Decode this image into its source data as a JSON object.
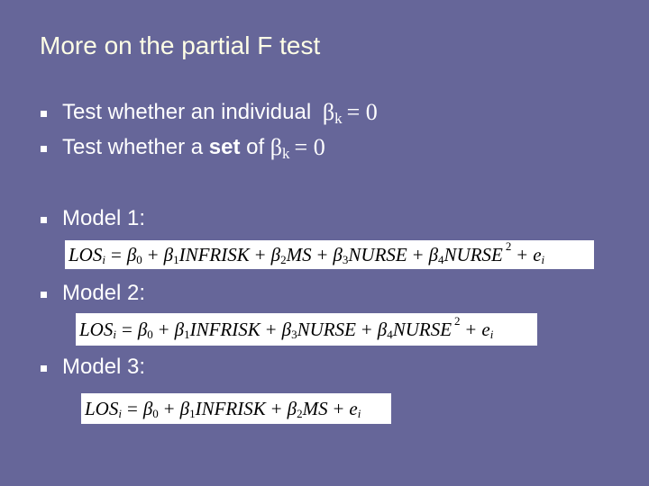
{
  "slide": {
    "title": "More on the partial F test",
    "background_color": "#666699",
    "title_color": "#FFFFE6",
    "bullets": [
      {
        "prefix": "Test whether an individual ",
        "bold": "",
        "suffix": "",
        "symbol": "β",
        "subscript": "k",
        "equals": "= 0"
      },
      {
        "prefix": "Test whether a ",
        "bold": "set",
        "suffix": " of ",
        "symbol": "β",
        "subscript": "k",
        "equals": "= 0"
      },
      {
        "label": "Model 1:"
      },
      {
        "label": "Model 2:"
      },
      {
        "label": "Model 3:"
      }
    ],
    "bullet_icon": "square-bullet",
    "models": [
      {
        "name": "Model 1",
        "lhs": "LOS",
        "lhs_sub": "i",
        "terms": [
          {
            "coef": "β",
            "sub": "0",
            "var": ""
          },
          {
            "coef": "β",
            "sub": "1",
            "var": "INFRISK"
          },
          {
            "coef": "β",
            "sub": "2",
            "var": "MS"
          },
          {
            "coef": "β",
            "sub": "3",
            "var": "NURSE"
          },
          {
            "coef": "β",
            "sub": "4",
            "var": "NURSE",
            "power": "2"
          }
        ],
        "error": "e",
        "error_sub": "i"
      },
      {
        "name": "Model 2",
        "lhs": "LOS",
        "lhs_sub": "i",
        "terms": [
          {
            "coef": "β",
            "sub": "0",
            "var": ""
          },
          {
            "coef": "β",
            "sub": "1",
            "var": "INFRISK"
          },
          {
            "coef": "β",
            "sub": "3",
            "var": "NURSE"
          },
          {
            "coef": "β",
            "sub": "4",
            "var": "NURSE",
            "power": "2"
          }
        ],
        "error": "e",
        "error_sub": "i"
      },
      {
        "name": "Model 3",
        "lhs": "LOS",
        "lhs_sub": "i",
        "terms": [
          {
            "coef": "β",
            "sub": "0",
            "var": ""
          },
          {
            "coef": "β",
            "sub": "1",
            "var": "INFRISK"
          },
          {
            "coef": "β",
            "sub": "2",
            "var": "MS"
          }
        ],
        "error": "e",
        "error_sub": "i"
      }
    ],
    "symbols": {
      "equals": "=",
      "plus": "+"
    }
  }
}
